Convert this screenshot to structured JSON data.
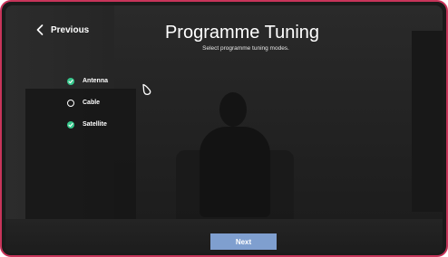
{
  "header": {
    "back_label": "Previous",
    "title": "Programme Tuning",
    "subtitle": "Select programme tuning modes."
  },
  "options": [
    {
      "label": "Antenna",
      "checked": true
    },
    {
      "label": "Cable",
      "checked": false
    },
    {
      "label": "Satellite",
      "checked": true
    }
  ],
  "footer": {
    "next_label": "Next"
  },
  "colors": {
    "check_green": "#35c58a",
    "button_blue": "#7f9fcf",
    "frame_border": "#c8345a"
  },
  "icons": {
    "back": "chevron-left-icon",
    "checked": "check-circle-icon",
    "unchecked": "empty-circle-icon",
    "pointer": "mouse-pointer-icon"
  }
}
